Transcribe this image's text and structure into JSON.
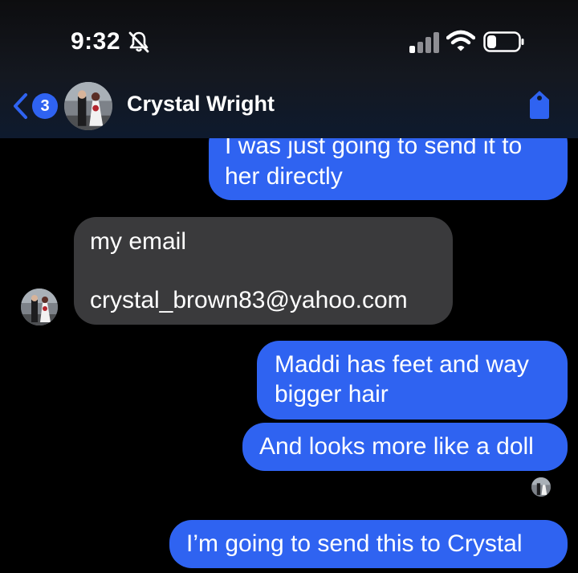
{
  "status_bar": {
    "time": "9:32",
    "icons": [
      "bell-slash-icon",
      "cellular-signal-icon",
      "wifi-icon",
      "battery-icon"
    ]
  },
  "header": {
    "back_badge_count": "3",
    "contact_name": "Crystal Wright",
    "accent_color": "#2f63f1"
  },
  "messages": [
    {
      "direction": "outgoing",
      "text": "I was just going to send it to her directly"
    },
    {
      "direction": "incoming",
      "lines": [
        "my email",
        "",
        "crystal_brown83@yahoo.com"
      ]
    },
    {
      "direction": "outgoing",
      "text": "Maddi has feet and way bigger hair"
    },
    {
      "direction": "outgoing",
      "text": "And looks more like a doll"
    },
    {
      "direction": "outgoing",
      "text": "I’m going to send this to Crystal"
    }
  ],
  "colors": {
    "outgoing_bubble": "#2f63f1",
    "incoming_bubble": "#3a3a3c",
    "background": "#000000"
  }
}
